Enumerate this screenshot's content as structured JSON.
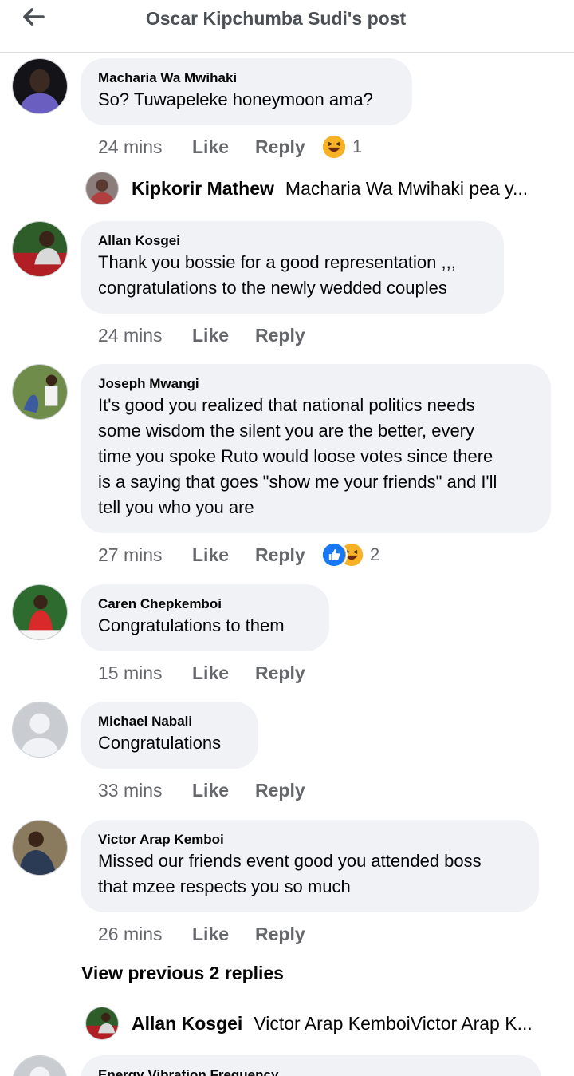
{
  "header": {
    "title": "Oscar Kipchumba Sudi's post",
    "back_icon": "arrow-left-icon"
  },
  "comments": [
    {
      "author": "Macharia Wa Mwihaki",
      "lines": [
        "So? Tuwapeleke honeymoon ama?"
      ],
      "time": "24 mins",
      "like": "Like",
      "reply": "Reply",
      "reaction_count": "1"
    },
    {
      "author": "Allan Kosgei",
      "lines": [
        "Thank you bossie for a good representation ,,,",
        "congratulations to the newly wedded couples"
      ],
      "time": "24 mins",
      "like": "Like",
      "reply": "Reply"
    },
    {
      "author": "Joseph Mwangi",
      "lines": [
        "It's good you realized that national politics needs",
        "some wisdom the silent you are the better, every",
        "time you spoke Ruto would loose votes since there",
        "is a saying that goes \"show me your friends\" and I'll",
        "tell you who you are"
      ],
      "time": "27 mins",
      "like": "Like",
      "reply": "Reply",
      "reaction_count": "2"
    },
    {
      "author": "Caren Chepkemboi",
      "lines": [
        "Congratulations  to them"
      ],
      "time": "15 mins",
      "like": "Like",
      "reply": "Reply"
    },
    {
      "author": "Michael Nabali",
      "lines": [
        "Congratulations"
      ],
      "time": "33 mins",
      "like": "Like",
      "reply": "Reply"
    },
    {
      "author": "Victor Arap Kemboi",
      "lines": [
        "Missed our friends event good you attended boss",
        "that mzee respects you so much"
      ],
      "time": "26 mins",
      "like": "Like",
      "reply": "Reply"
    },
    {
      "author": "Energy Vibration Frequency"
    }
  ],
  "replies": [
    {
      "author": "Kipkorir Mathew",
      "snippet": "Macharia Wa Mwihaki pea y..."
    },
    {
      "author": "Allan Kosgei",
      "snippet": "Victor Arap KemboiVictor Arap K..."
    }
  ],
  "view_previous": "View previous 2 replies",
  "colors": {
    "bubble": "#f0f2f5",
    "meta": "#65676b",
    "like_blue": "#1877f2",
    "haha_yellow": "#f7b125"
  }
}
